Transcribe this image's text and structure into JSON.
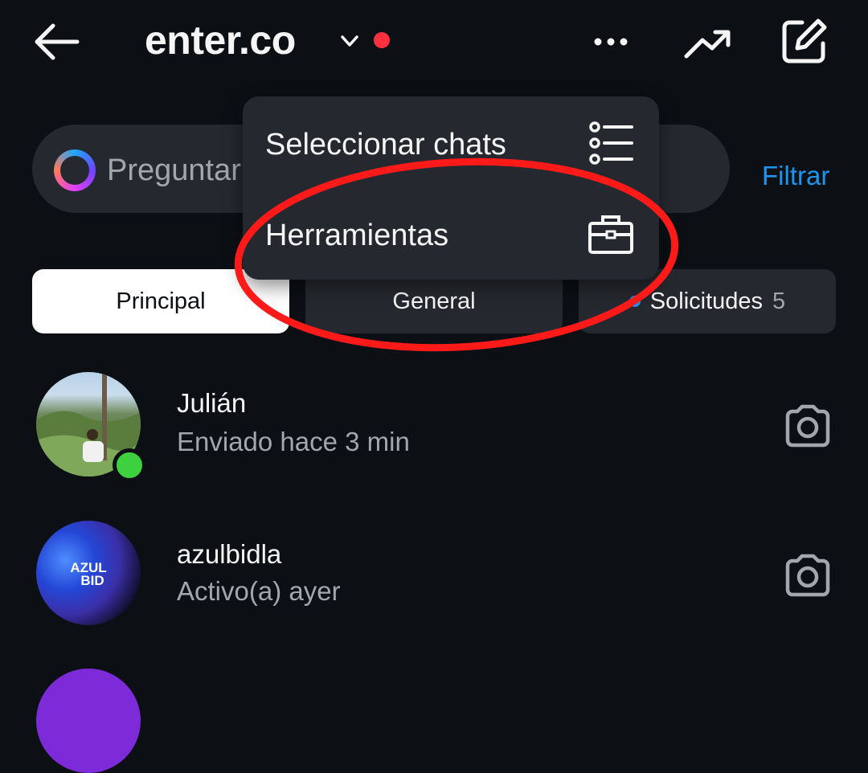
{
  "header": {
    "title": "enter.co",
    "icons": [
      "back-arrow-icon",
      "chevron-down-icon",
      "more-icon",
      "insights-icon",
      "compose-icon"
    ],
    "unread_dot_color": "#ff3040"
  },
  "search": {
    "placeholder": "Preguntar a Meta AI o buscar",
    "visible_text_left": "Preguntar",
    "filter_label": "Filtrar"
  },
  "tabs": [
    {
      "label": "Principal",
      "selected": true
    },
    {
      "label": "General",
      "selected": false
    },
    {
      "label": "Solicitudes",
      "count": "5",
      "selected": false
    }
  ],
  "chats": [
    {
      "name": "Julián",
      "status": "Enviado hace 3 min",
      "online": true
    },
    {
      "name": "azulbidla",
      "status": "Activo(a) ayer",
      "online": false,
      "avatar_text": "AZUL BID"
    }
  ],
  "menu": {
    "items": [
      {
        "label": "Seleccionar chats",
        "icon": "list-icon"
      },
      {
        "label": "Herramientas",
        "icon": "briefcase-icon"
      }
    ]
  },
  "colors": {
    "background": "#0c0f14",
    "surface": "#25282e",
    "accent": "#1a96f0",
    "annotation": "#ff1a1a",
    "online": "#3ed13f"
  }
}
